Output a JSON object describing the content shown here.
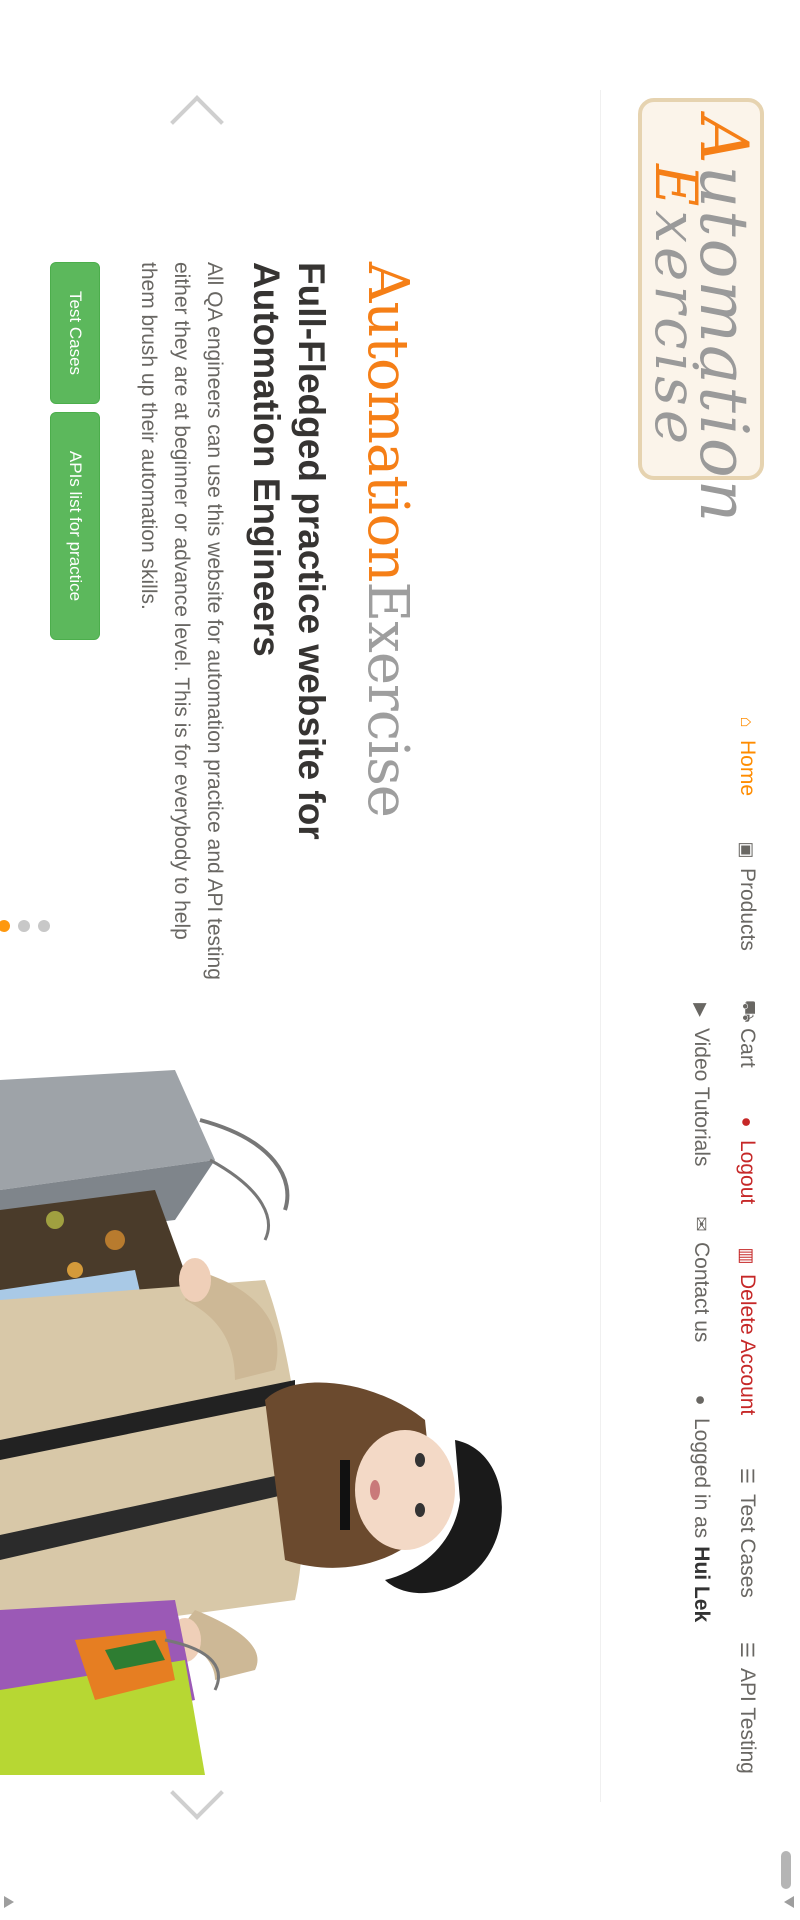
{
  "logo": {
    "line1_cap": "A",
    "line1_rest": "utomation",
    "line2_cap": "E",
    "line2_rest": "xercise"
  },
  "nav": {
    "home": "Home",
    "products": "Products",
    "cart": "Cart",
    "logout": "Logout",
    "delete_account": "Delete Account",
    "test_cases": "Test Cases",
    "api_testing": "API Testing",
    "video_tutorials": "Video Tutorials",
    "contact_us": "Contact us",
    "logged_in_prefix": "Logged in as",
    "username": "Hui Lek"
  },
  "hero": {
    "brand_a": "Automation",
    "brand_b": "Exercise",
    "headline": "Full-Fledged practice website for Automation Engineers",
    "description": "All QA engineers can use this website for automation practice and API testing either they are at beginner or advance level. This is for everybody to help them brush up their automation skills.",
    "btn_test_cases": "Test Cases",
    "btn_apis": "APIs list for practice"
  },
  "colors": {
    "accent": "#f57f17",
    "danger": "#c62828",
    "button": "#5cb85c",
    "text": "#696763"
  },
  "carousel": {
    "slides": 3,
    "active_slide": 1
  }
}
